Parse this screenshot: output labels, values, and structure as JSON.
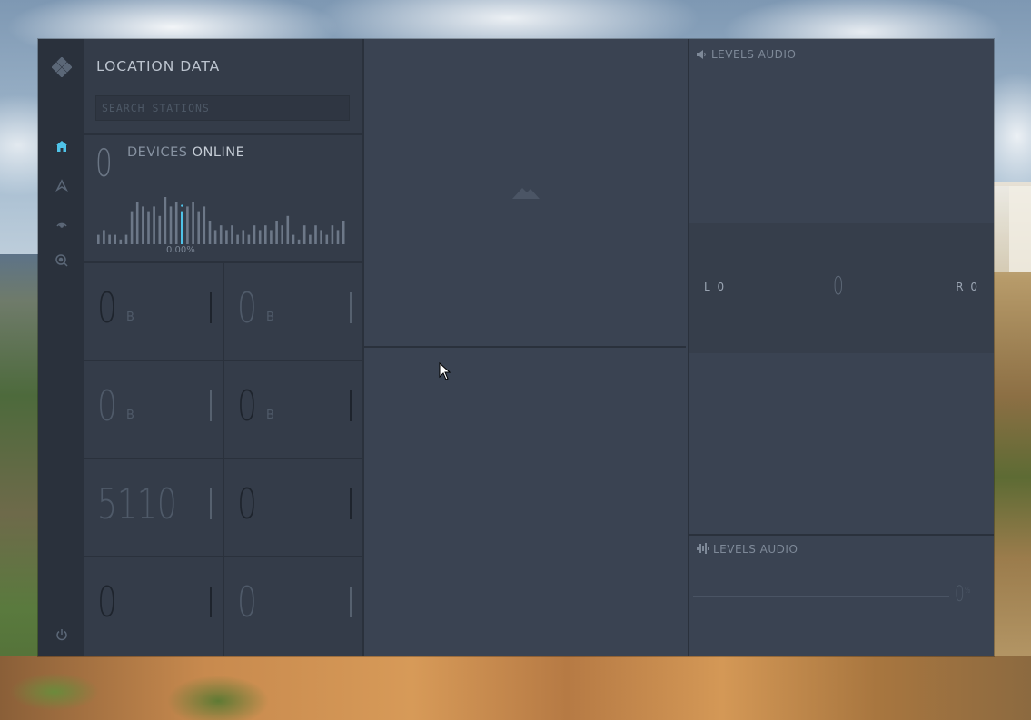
{
  "app": {
    "title": "LOCATION DATA",
    "search_placeholder": "SEARCH STATIONS",
    "accent": "#4fc3e8"
  },
  "sidebar": {
    "items": [
      {
        "name": "home",
        "icon": "home-icon",
        "active": true
      },
      {
        "name": "location",
        "icon": "location-pin-icon",
        "active": false
      },
      {
        "name": "broadcast",
        "icon": "broadcast-icon",
        "active": false
      },
      {
        "name": "search-location",
        "icon": "search-location-icon",
        "active": false
      }
    ],
    "footer_icon": "power-icon"
  },
  "devices": {
    "count": "0",
    "label_prefix": "DEVICES",
    "label_suffix": "ONLINE",
    "percent": "0.00%",
    "activity": [
      2,
      3,
      2,
      2,
      1,
      2,
      7,
      9,
      8,
      7,
      8,
      6,
      10,
      8,
      9,
      7,
      8,
      9,
      7,
      8,
      5,
      3,
      4,
      3,
      4,
      2,
      3,
      2,
      4,
      3,
      4,
      3,
      5,
      4,
      6,
      2,
      1,
      4,
      2,
      4,
      3,
      2,
      4,
      3,
      5
    ],
    "highlight_index": 15
  },
  "tiles": [
    {
      "value": "0",
      "unit": "B",
      "dark": true
    },
    {
      "value": "0",
      "unit": "B",
      "dark": false
    },
    {
      "value": "0",
      "unit": "B",
      "dark": false
    },
    {
      "value": "0",
      "unit": "B",
      "dark": true
    },
    {
      "value": "5110",
      "unit": "",
      "dark": false
    },
    {
      "value": "0",
      "unit": "",
      "dark": true
    },
    {
      "value": "0",
      "unit": "",
      "dark": true
    },
    {
      "value": "0",
      "unit": "",
      "dark": false
    }
  ],
  "audio_top": {
    "title": "LEVELS AUDIO",
    "left_label": "L 0",
    "center_value": "0",
    "right_label": "R 0"
  },
  "audio_bottom": {
    "title": "LEVELS AUDIO",
    "percent_value": "0",
    "percent_sign": "%"
  }
}
